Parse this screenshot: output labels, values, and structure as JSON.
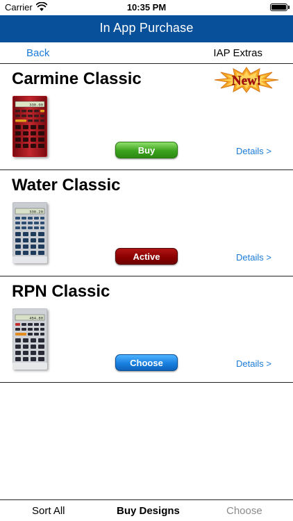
{
  "status_bar": {
    "carrier": "Carrier",
    "time": "10:35 PM"
  },
  "header": {
    "title": "In App Purchase"
  },
  "nav": {
    "back_label": "Back",
    "right_label": "IAP Extras"
  },
  "products": [
    {
      "name": "Carmine Classic",
      "badge": "New!",
      "display_value": "330.00",
      "button_label": "Buy",
      "button_color": "#3ca21e",
      "details_label": "Details >",
      "theme": "carmine"
    },
    {
      "name": "Water Classic",
      "display_value": "330.20",
      "button_label": "Active",
      "button_color": "#8a0000",
      "details_label": "Details >",
      "theme": "water"
    },
    {
      "name": "RPN Classic",
      "display_value": "454.80",
      "button_label": "Choose",
      "button_color": "#1a80e0",
      "details_label": "Details >",
      "theme": "rpn"
    }
  ],
  "tabs": [
    {
      "label": "Sort All",
      "state": "normal"
    },
    {
      "label": "Buy Designs",
      "state": "selected"
    },
    {
      "label": "Choose",
      "state": "disabled"
    }
  ],
  "colors": {
    "header_bg": "#08509a",
    "link": "#1a7ad6"
  }
}
